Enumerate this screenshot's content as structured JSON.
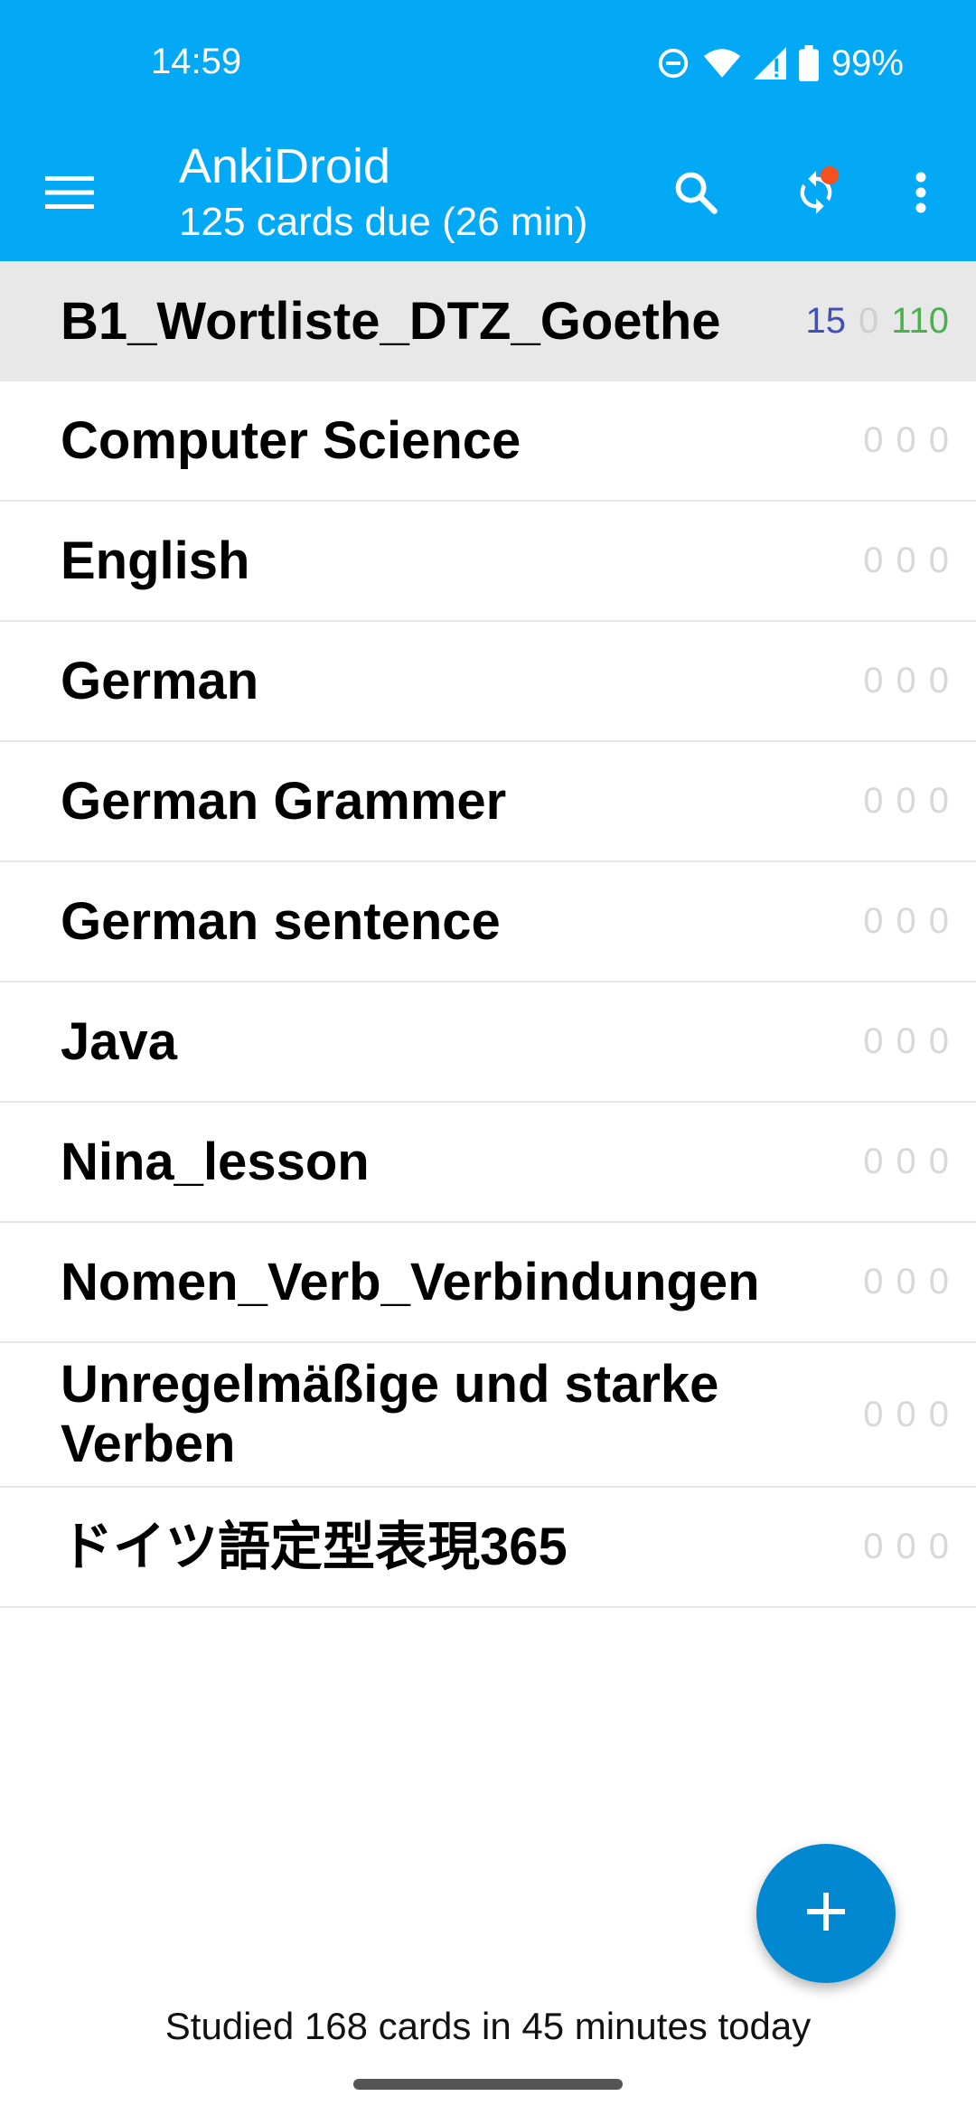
{
  "status_bar": {
    "time": "14:59",
    "battery": "99%",
    "icons": [
      "do-not-disturb-icon",
      "wifi-icon",
      "signal-icon",
      "battery-icon"
    ]
  },
  "toolbar": {
    "title": "AnkiDroid",
    "subtitle": "125 cards due (26 min)",
    "icons": [
      "menu-icon",
      "search-icon",
      "sync-icon",
      "more-icon"
    ],
    "accent": "#03A9F4",
    "sync_badge_color": "#F4511E"
  },
  "decks": [
    {
      "name": "B1_Wortliste_DTZ_Goethe",
      "new": "15",
      "learn": "0",
      "review": "110",
      "selected": true
    },
    {
      "name": "Computer Science",
      "new": "0",
      "learn": "0",
      "review": "0"
    },
    {
      "name": "English",
      "new": "0",
      "learn": "0",
      "review": "0"
    },
    {
      "name": "German",
      "new": "0",
      "learn": "0",
      "review": "0"
    },
    {
      "name": "German Grammer",
      "new": "0",
      "learn": "0",
      "review": "0"
    },
    {
      "name": "German sentence",
      "new": "0",
      "learn": "0",
      "review": "0"
    },
    {
      "name": "Java",
      "new": "0",
      "learn": "0",
      "review": "0"
    },
    {
      "name": "Nina_lesson",
      "new": "0",
      "learn": "0",
      "review": "0"
    },
    {
      "name": "Nomen_Verb_Verbindungen",
      "new": "0",
      "learn": "0",
      "review": "0"
    },
    {
      "name": "Unregelmäßige und starke Verben",
      "new": "0",
      "learn": "0",
      "review": "0"
    },
    {
      "name": "ドイツ語定型表現365",
      "new": "0",
      "learn": "0",
      "review": "0"
    }
  ],
  "colors": {
    "new_count": "#3F51B5",
    "learn_count": "#cfcfcf",
    "review_count": "#4CAF50",
    "fab": "#0288D1"
  },
  "fab_icon": "plus-icon",
  "footer": "Studied 168 cards in 45 minutes today"
}
